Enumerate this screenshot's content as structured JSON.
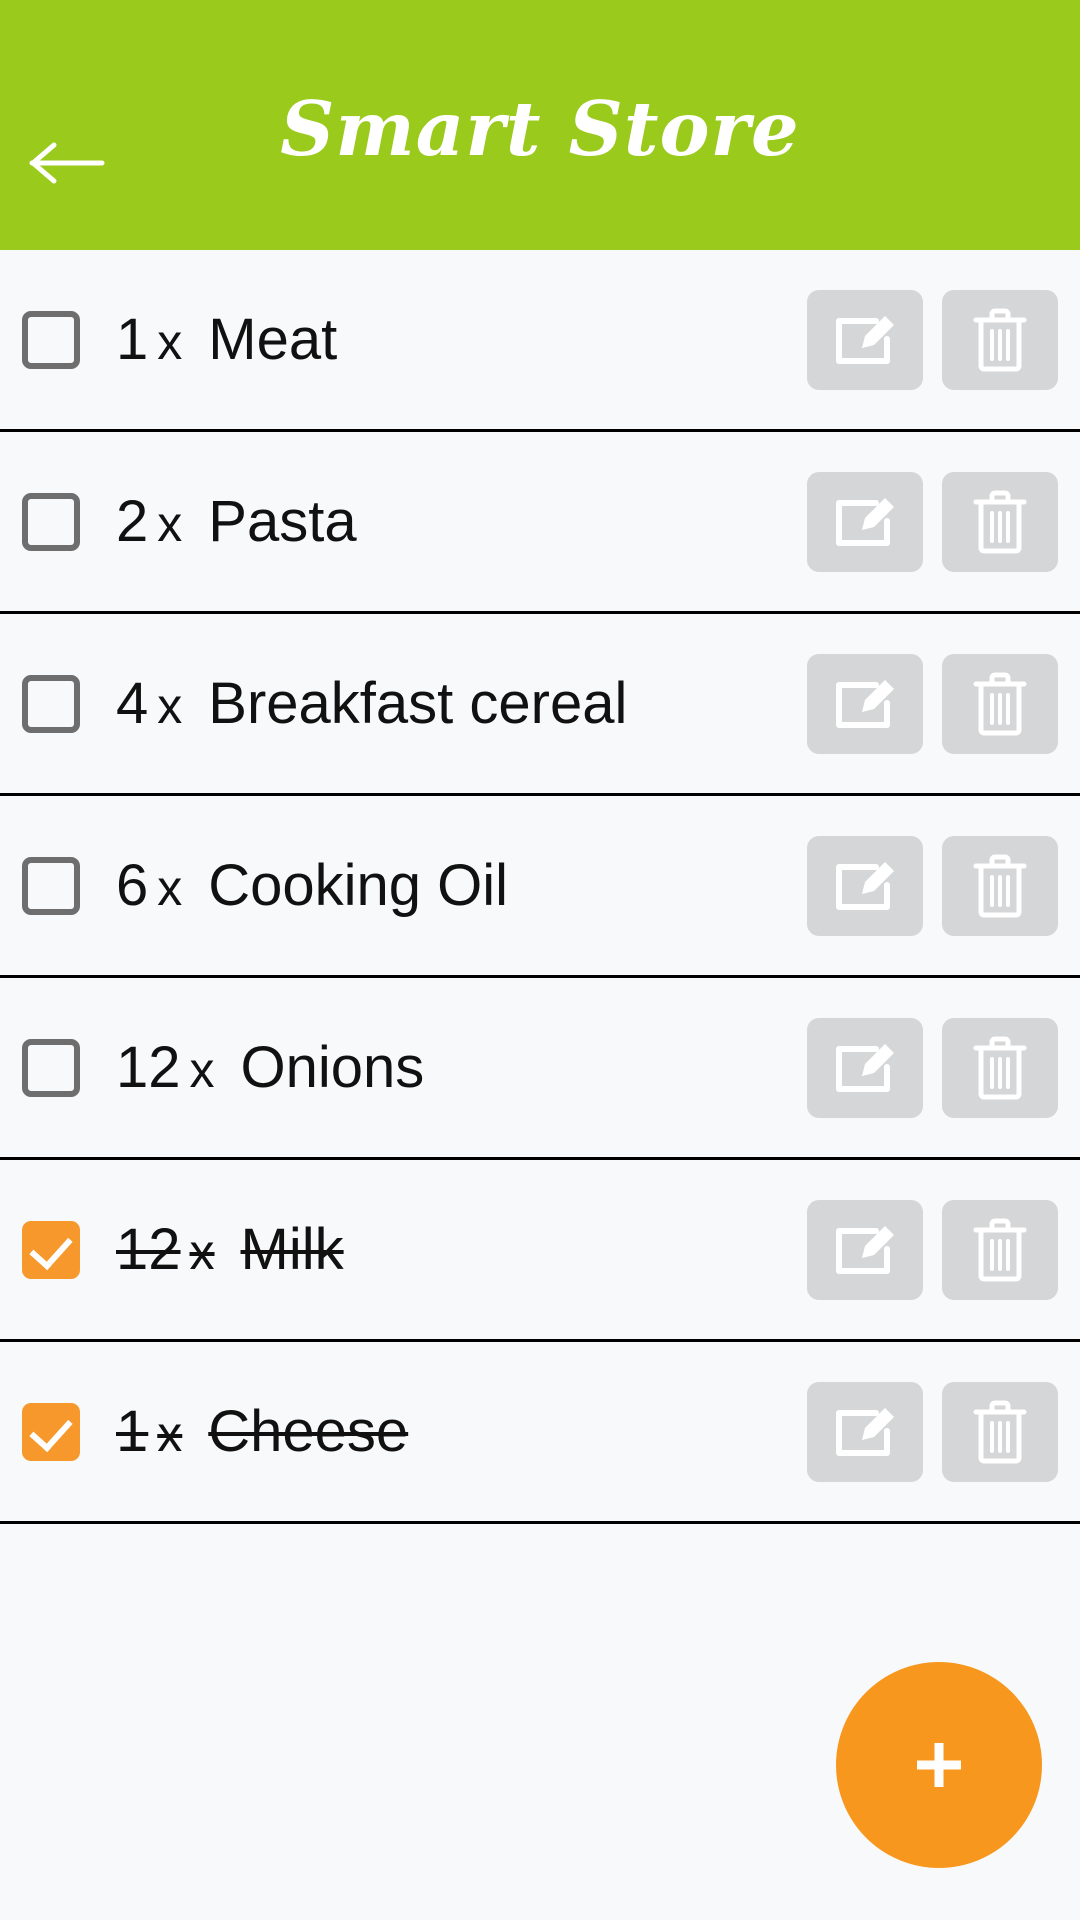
{
  "theme": {
    "header_green": "#9ACA1C",
    "accent_orange": "#F8971D",
    "checkbox_checked": "#F6982B",
    "button_gray": "#d5d6d7",
    "background": "#f8f9fa",
    "divider": "#000000"
  },
  "header": {
    "title": "Smart Store",
    "back_icon": "arrow-left-icon"
  },
  "list": {
    "multiplier_symbol": "x",
    "items": [
      {
        "checked": false,
        "quantity": "1",
        "multiplier": "x",
        "name": "Meat",
        "edit_label": "Edit",
        "delete_label": "Delete"
      },
      {
        "checked": false,
        "quantity": "2",
        "multiplier": "x",
        "name": "Pasta",
        "edit_label": "Edit",
        "delete_label": "Delete"
      },
      {
        "checked": false,
        "quantity": "4",
        "multiplier": "x",
        "name": "Breakfast cereal",
        "edit_label": "Edit",
        "delete_label": "Delete"
      },
      {
        "checked": false,
        "quantity": "6",
        "multiplier": "x",
        "name": "Cooking Oil",
        "edit_label": "Edit",
        "delete_label": "Delete"
      },
      {
        "checked": false,
        "quantity": "12",
        "multiplier": "x",
        "name": "Onions",
        "edit_label": "Edit",
        "delete_label": "Delete"
      },
      {
        "checked": true,
        "quantity": "12",
        "multiplier": "x",
        "name": "Milk",
        "edit_label": "Edit",
        "delete_label": "Delete"
      },
      {
        "checked": true,
        "quantity": "1",
        "multiplier": "x",
        "name": "Cheese",
        "edit_label": "Edit",
        "delete_label": "Delete"
      }
    ]
  },
  "fab": {
    "label": "+",
    "icon": "plus-icon",
    "action": "add-item"
  }
}
